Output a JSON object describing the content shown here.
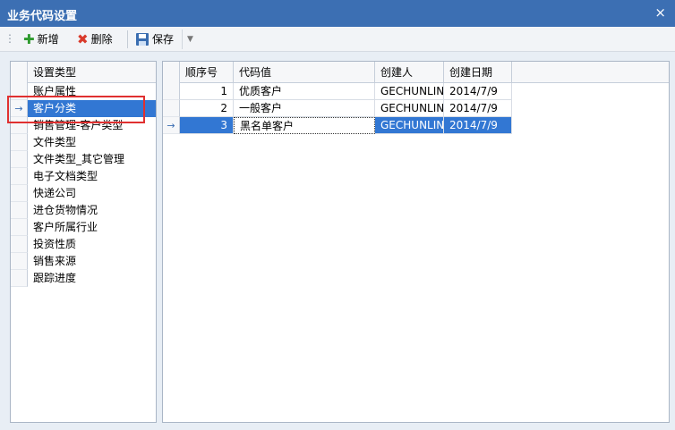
{
  "window": {
    "title": "业务代码设置",
    "close_glyph": "×"
  },
  "toolbar": {
    "add_label": "新增",
    "delete_label": "删除",
    "save_label": "保存"
  },
  "left": {
    "header": "设置类型",
    "selected_index": 1,
    "items": [
      "账户属性",
      "客户分类",
      "销售管理-客户类型",
      "文件类型",
      "文件类型_其它管理",
      "电子文档类型",
      "快递公司",
      "进仓货物情况",
      "客户所属行业",
      "投资性质",
      "销售来源",
      "跟踪进度"
    ]
  },
  "grid": {
    "columns": [
      "顺序号",
      "代码值",
      "创建人",
      "创建日期"
    ],
    "selected_index": 2,
    "rows": [
      {
        "order": "1",
        "code": "优质客户",
        "creator": "GECHUNLIN",
        "date": "2014/7/9"
      },
      {
        "order": "2",
        "code": "一般客户",
        "creator": "GECHUNLIN",
        "date": "2014/7/9"
      },
      {
        "order": "3",
        "code": "黑名单客户",
        "creator": "GECHUNLIN",
        "date": "2014/7/9"
      }
    ]
  },
  "colors": {
    "titlebar": "#3c6fb3",
    "selection": "#3277d3",
    "highlight_box": "#e03030"
  },
  "icons": {
    "add": "plus-icon",
    "delete": "x-icon",
    "save": "floppy-icon",
    "row_pointer": "arrow-right-icon"
  }
}
